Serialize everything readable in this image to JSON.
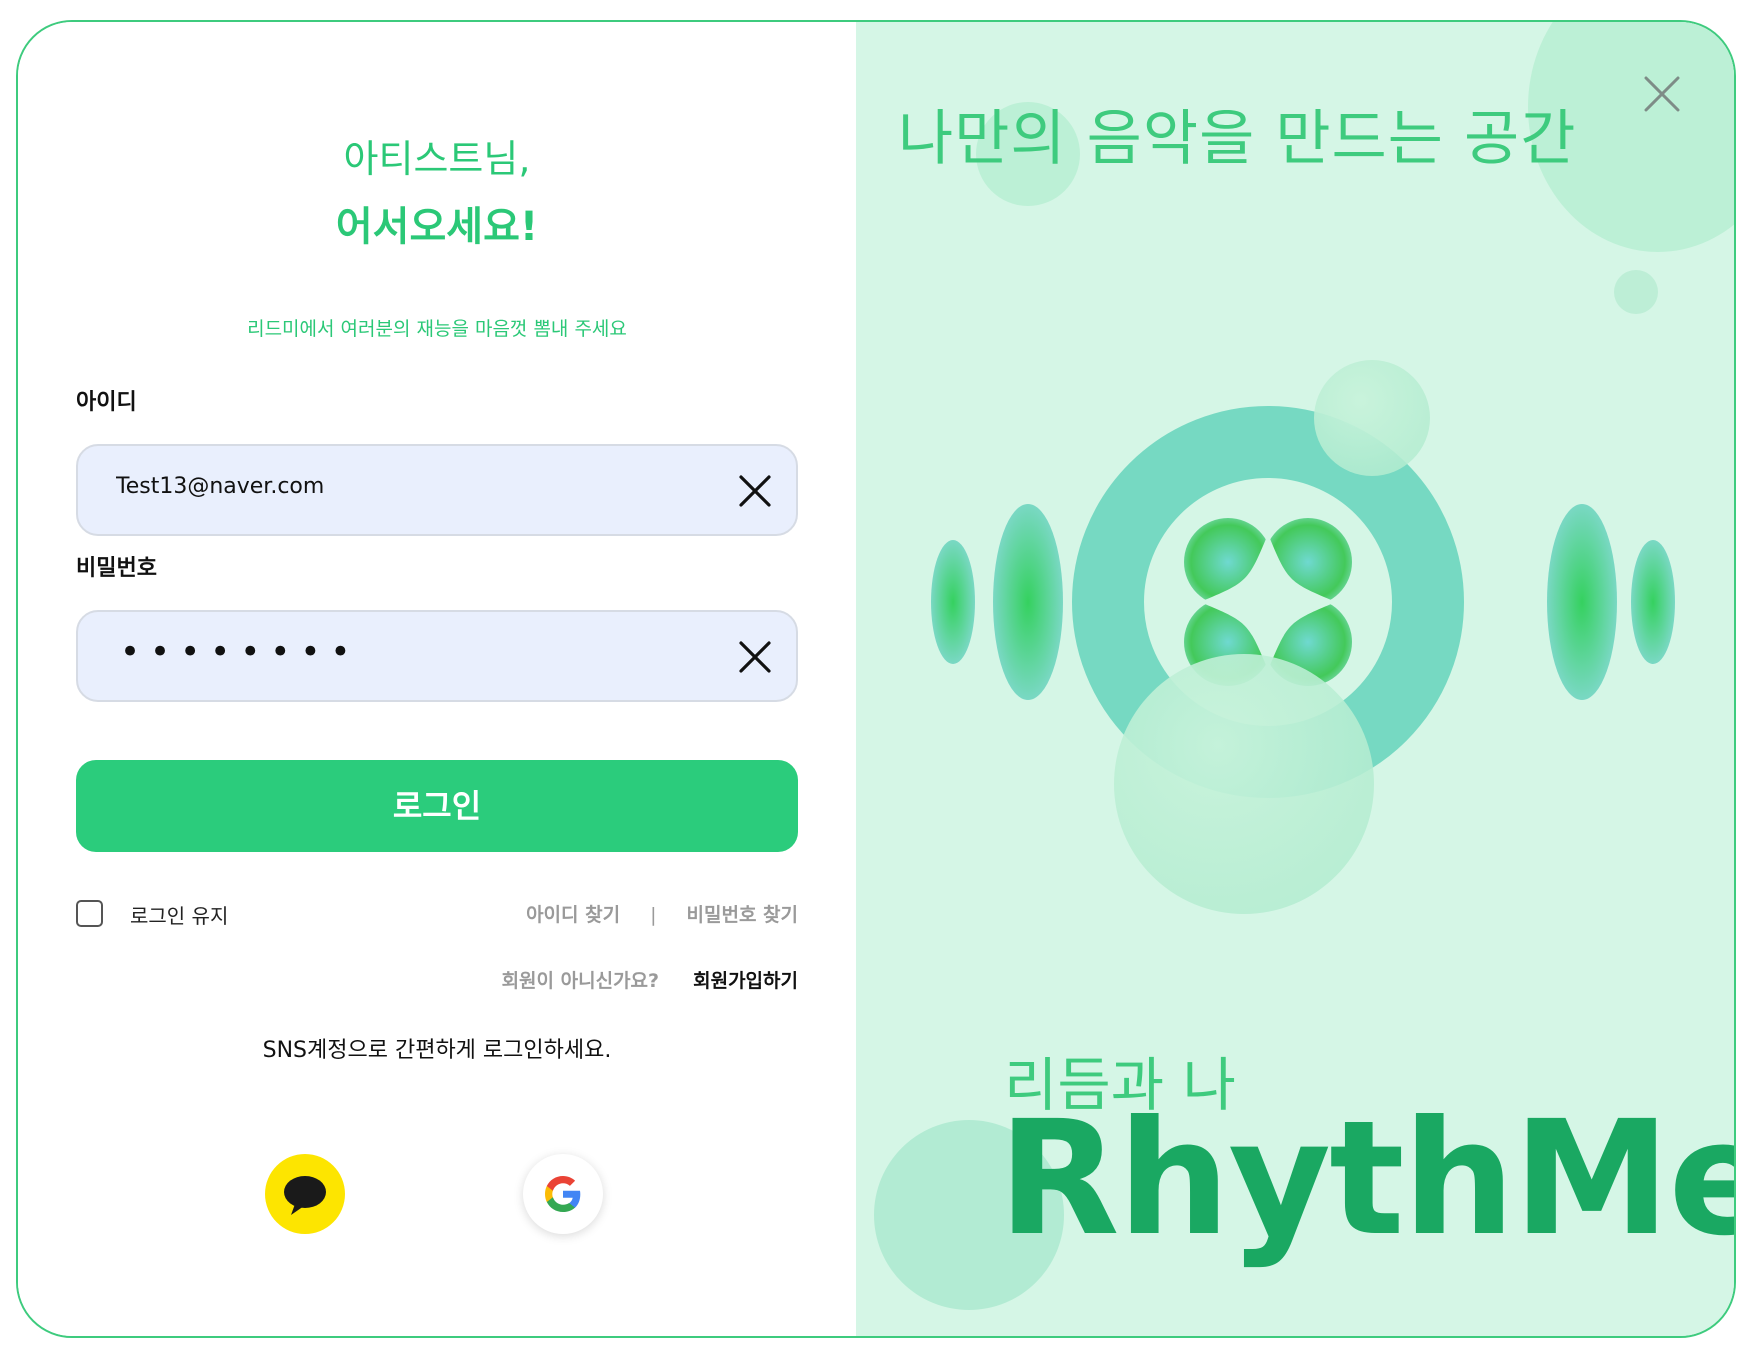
{
  "left": {
    "greeting_line1": "아티스트님,",
    "greeting_line2": "어서오세요!",
    "subtitle": "리드미에서 여러분의 재능을 마음껏 뽐내 주세요",
    "id_label": "아이디",
    "id_value": "Test13@naver.com",
    "password_label": "비밀번호",
    "password_masked": "••••••••",
    "login_button": "로그인",
    "keep_login_label": "로그인 유지",
    "keep_login_checked": false,
    "find_id": "아이디 찾기",
    "separator": "|",
    "find_password": "비밀번호 찾기",
    "signup_question": "회원이 아니신가요?",
    "signup_link": "회원가입하기",
    "sns_text": "SNS계정으로 간편하게 로그인하세요.",
    "sns_buttons": [
      {
        "icon": "kakao-talk-icon",
        "color": "#fde500"
      },
      {
        "icon": "google-icon",
        "color": "#ffffff"
      }
    ]
  },
  "right": {
    "title": "나만의 음악을 만드는 공간",
    "tagline": "리듬과 나",
    "brand": "RhythMe",
    "close_icon": "close-icon",
    "background_color": "#d5f6e6"
  },
  "colors": {
    "accent": "#2bcc7c",
    "input_bg": "#e9effd",
    "border": "#3ecb7e"
  }
}
